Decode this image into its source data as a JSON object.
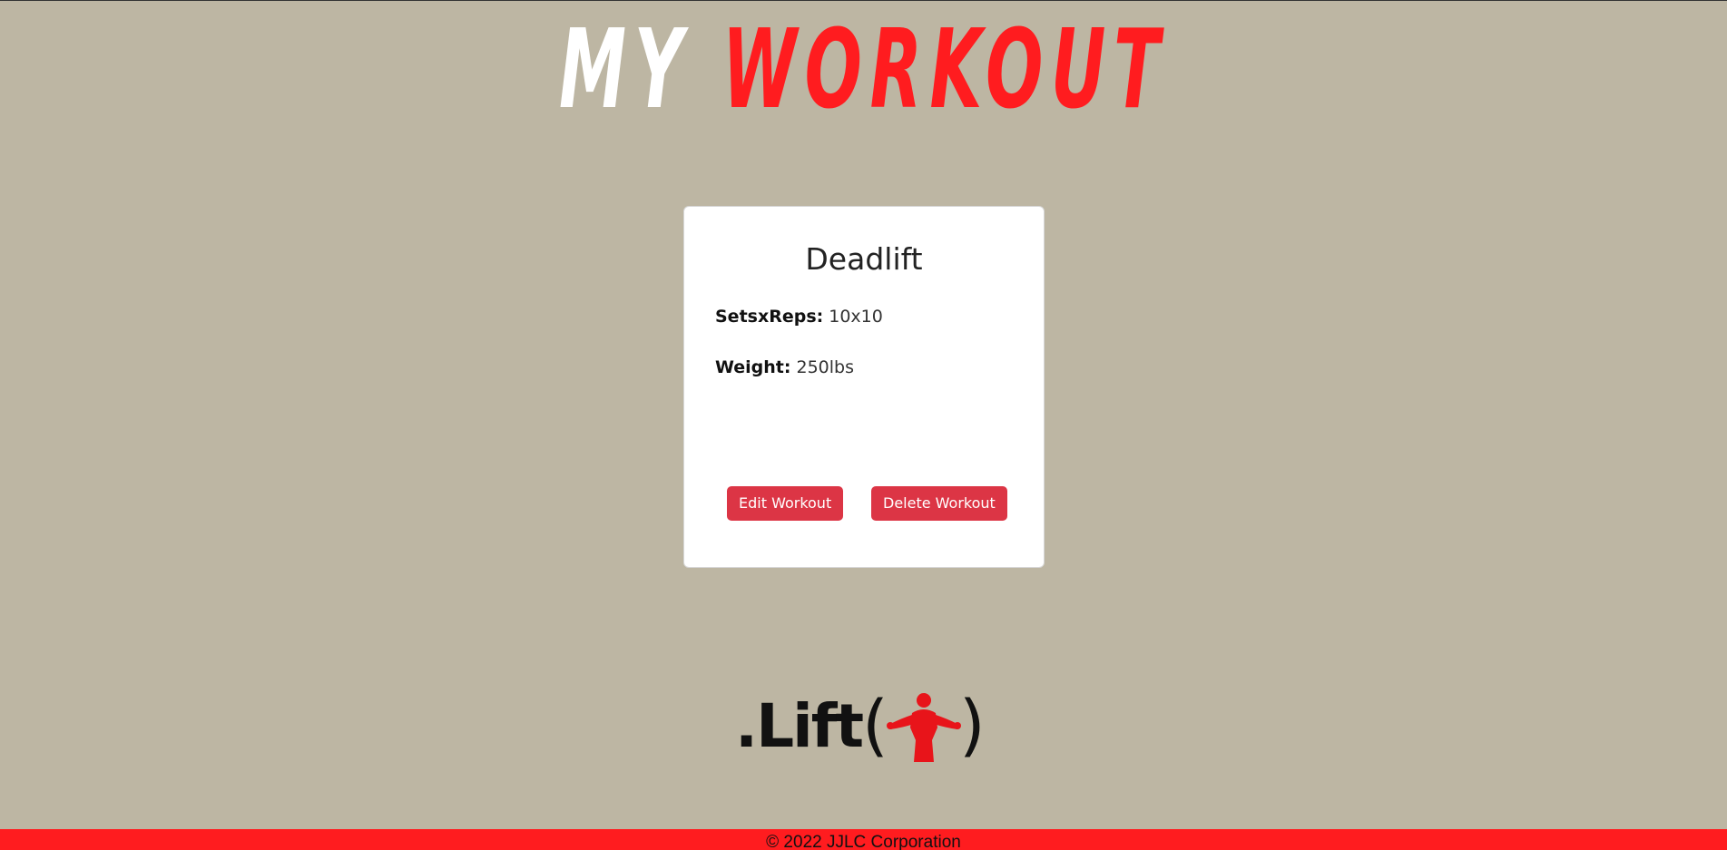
{
  "header": {
    "title_part1": "MY",
    "title_part2": "WORKOUT"
  },
  "card": {
    "title": "Deadlift",
    "sets_label": "SetsxReps:",
    "sets_value": "10x10",
    "weight_label": "Weight:",
    "weight_value": "250lbs",
    "edit_button": "Edit Workout",
    "delete_button": "Delete Workout"
  },
  "logo": {
    "text": ".Lift",
    "open_paren": "(",
    "close_paren": ")",
    "icon": "lifter-icon"
  },
  "footer": {
    "copyright": "© 2022 JJLC Corporation"
  },
  "colors": {
    "background": "#bdb6a3",
    "accent": "#ff1c1f",
    "button": "#dc3545"
  }
}
